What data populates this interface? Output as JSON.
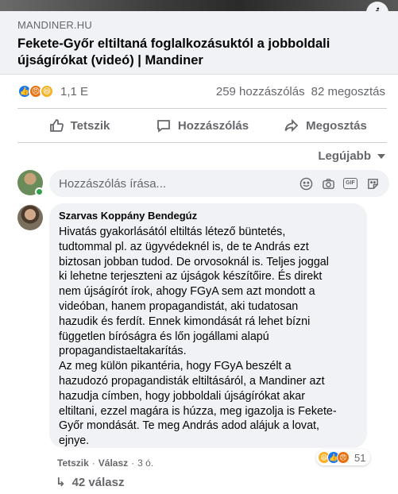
{
  "link": {
    "source": "MANDINER.HU",
    "title": "Fekete-Győr eltiltaná foglalkozásuktól a jobboldali újságírókat (videó) | Mandiner"
  },
  "stats": {
    "reaction_count": "1,1 E",
    "comments": "259 hozzászólás",
    "shares": "82 megosztás"
  },
  "actions": {
    "like": "Tetszik",
    "comment": "Hozzászólás",
    "share": "Megosztás"
  },
  "sort": {
    "label": "Legújabb"
  },
  "compose": {
    "placeholder": "Hozzászólás írása..."
  },
  "comment": {
    "author": "Szarvas Koppány Bendegúz",
    "text": "Hivatás gyakorlásától eltiltás létező büntetés,\ntudtommal pl. az ügyvédeknél is, de te András ezt\nbiztosan jobban tudod. De orvosoknál is. Teljes joggal\nki lehetne terjeszteni az újságok készítőire. És direkt\nnem újságírót írok, ahogy FGyA sem azt mondott a\nvideóban, hanem propagandistát, aki tudatosan\nhazudik és ferdít. Ennek kimondását rá lehet bízni\nfüggetlen bíróságra és lőn jogállami alapú\npropagandistaeltakarítás.\nAz meg külön pikantéria, hogy FGyA beszélt a\nhazudozó propagandisták eltiltásáról, a Mandiner azt\nhazudja címben, hogy jobboldali újságírókat akar\neltiltani, ezzel magára is húzza, meg igazolja is Fekete-\nGyőr mondását. Te meg András adod alájuk a lovat,\nejnye.",
    "like_label": "Tetszik",
    "reply_label": "Válasz",
    "time": "3 ó.",
    "reaction_count": "51",
    "replies": "42 válasz"
  },
  "colors": {
    "like_blue": "#1877f2",
    "angry_orange": "#e9710f",
    "haha_yellow": "#f7b125",
    "online_green": "#31a24c"
  }
}
